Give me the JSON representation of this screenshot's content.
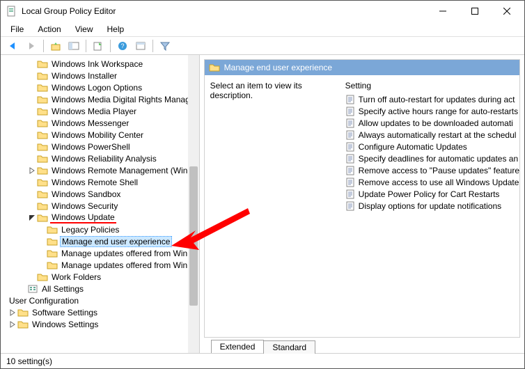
{
  "window": {
    "title": "Local Group Policy Editor"
  },
  "menus": [
    "File",
    "Action",
    "View",
    "Help"
  ],
  "tree": {
    "items": [
      {
        "indent": 2,
        "label": "Windows Ink Workspace"
      },
      {
        "indent": 2,
        "label": "Windows Installer"
      },
      {
        "indent": 2,
        "label": "Windows Logon Options"
      },
      {
        "indent": 2,
        "label": "Windows Media Digital Rights Manage"
      },
      {
        "indent": 2,
        "label": "Windows Media Player"
      },
      {
        "indent": 2,
        "label": "Windows Messenger"
      },
      {
        "indent": 2,
        "label": "Windows Mobility Center"
      },
      {
        "indent": 2,
        "label": "Windows PowerShell"
      },
      {
        "indent": 2,
        "label": "Windows Reliability Analysis"
      },
      {
        "indent": 2,
        "label": "Windows Remote Management (WinR",
        "caret": ">"
      },
      {
        "indent": 2,
        "label": "Windows Remote Shell"
      },
      {
        "indent": 2,
        "label": "Windows Sandbox"
      },
      {
        "indent": 2,
        "label": "Windows Security"
      },
      {
        "indent": 2,
        "label": "Windows Update",
        "caret": "v",
        "red": true
      },
      {
        "indent": 3,
        "label": "Legacy Policies"
      },
      {
        "indent": 3,
        "label": "Manage end user experience",
        "selected": true,
        "red": true
      },
      {
        "indent": 3,
        "label": "Manage updates offered from Win"
      },
      {
        "indent": 3,
        "label": "Manage updates offered from Win"
      },
      {
        "indent": 2,
        "label": "Work Folders"
      },
      {
        "indent": 1,
        "label": "All Settings",
        "icontype": "settings"
      },
      {
        "indent": 0,
        "label": "User Configuration",
        "notree": true
      },
      {
        "indent": 0,
        "label": "Software Settings",
        "caret": ">"
      },
      {
        "indent": 0,
        "label": "Windows Settings",
        "caret": ">",
        "partial": true
      }
    ]
  },
  "right": {
    "pathbar": "Manage end user experience",
    "desc": "Select an item to view its description.",
    "setting_header": "Setting",
    "items": [
      "Turn off auto-restart for updates during act",
      "Specify active hours range for auto-restarts",
      "Allow updates to be downloaded automati",
      "Always automatically restart at the schedul",
      "Configure Automatic Updates",
      "Specify deadlines for automatic updates an",
      "Remove access to \"Pause updates\" feature",
      "Remove access to use all Windows Update",
      "Update Power Policy for Cart Restarts",
      "Display options for update notifications"
    ]
  },
  "tabs": {
    "extended": "Extended",
    "standard": "Standard"
  },
  "statusbar": "10 setting(s)"
}
